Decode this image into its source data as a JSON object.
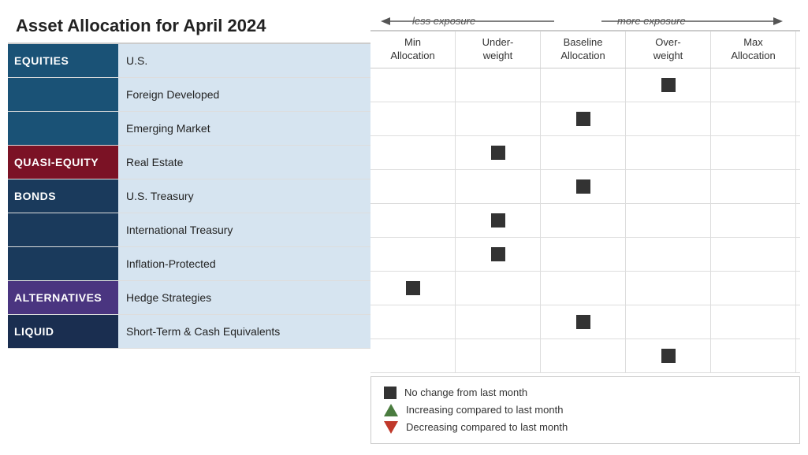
{
  "title": "Asset Allocation for April 2024",
  "exposure": {
    "less": "less exposure",
    "more": "more exposure"
  },
  "columns": [
    {
      "id": "min",
      "label": "Min\nAllocation"
    },
    {
      "id": "underweight",
      "label": "Under-\nweight"
    },
    {
      "id": "baseline",
      "label": "Baseline\nAllocation"
    },
    {
      "id": "overweight",
      "label": "Over-\nweight"
    },
    {
      "id": "max",
      "label": "Max\nAllocation"
    }
  ],
  "rows": [
    {
      "category": "EQUITIES",
      "cat_class": "cat-equities",
      "sub": "U.S.",
      "sub_class": "sub-cell",
      "marker_col": "overweight"
    },
    {
      "category": "",
      "cat_class": "cat-equities",
      "sub": "Foreign Developed",
      "sub_class": "sub-cell",
      "marker_col": "baseline"
    },
    {
      "category": "",
      "cat_class": "cat-equities",
      "sub": "Emerging Market",
      "sub_class": "sub-cell",
      "marker_col": "underweight"
    },
    {
      "category": "QUASI-EQUITY",
      "cat_class": "cat-quasi",
      "sub": "Real Estate",
      "sub_class": "sub-cell",
      "marker_col": "baseline"
    },
    {
      "category": "BONDS",
      "cat_class": "cat-bonds",
      "sub": "U.S. Treasury",
      "sub_class": "sub-cell",
      "marker_col": "underweight"
    },
    {
      "category": "",
      "cat_class": "cat-bonds",
      "sub": "International Treasury",
      "sub_class": "sub-cell",
      "marker_col": "underweight"
    },
    {
      "category": "",
      "cat_class": "cat-bonds",
      "sub": "Inflation-Protected",
      "sub_class": "sub-cell",
      "marker_col": "min"
    },
    {
      "category": "ALTERNATIVES",
      "cat_class": "cat-alternatives",
      "sub": "Hedge Strategies",
      "sub_class": "sub-cell",
      "marker_col": "baseline"
    },
    {
      "category": "LIQUID",
      "cat_class": "cat-liquid",
      "sub": "Short-Term & Cash Equivalents",
      "sub_class": "sub-cell",
      "marker_col": "overweight"
    }
  ],
  "legend": [
    {
      "type": "square",
      "text": "No change from last month"
    },
    {
      "type": "triangle-up",
      "text": "Increasing compared to last month"
    },
    {
      "type": "triangle-down",
      "text": "Decreasing compared to last month"
    }
  ]
}
